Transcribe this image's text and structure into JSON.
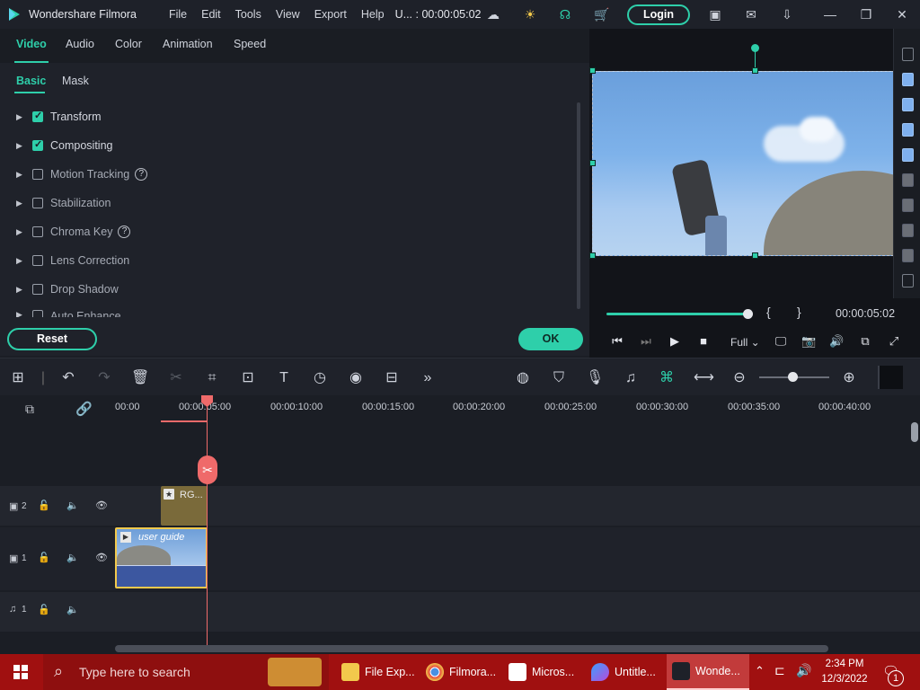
{
  "titlebar": {
    "app_title": "Wondershare Filmora",
    "menu": [
      "File",
      "Edit",
      "Tools",
      "View",
      "Export",
      "Help"
    ],
    "project": "U... : 00:00:05:02",
    "login_label": "Login"
  },
  "panel": {
    "tabs": [
      "Video",
      "Audio",
      "Color",
      "Animation",
      "Speed"
    ],
    "subtabs": [
      "Basic",
      "Mask"
    ],
    "properties": [
      {
        "label": "Transform",
        "checked": true
      },
      {
        "label": "Compositing",
        "checked": true
      },
      {
        "label": "Motion Tracking",
        "checked": false
      },
      {
        "label": "Stabilization",
        "checked": false
      },
      {
        "label": "Chroma Key",
        "checked": false
      },
      {
        "label": "Lens Correction",
        "checked": false
      },
      {
        "label": "Drop Shadow",
        "checked": false
      },
      {
        "label": "Auto Enhance",
        "checked": false
      }
    ],
    "reset_label": "Reset",
    "ok_label": "OK"
  },
  "preview": {
    "mark_in": "{",
    "mark_out": "}",
    "timecode": "00:00:05:02",
    "quality": "Full",
    "progress": 0.97
  },
  "timeline": {
    "ruler_labels": [
      "00:00",
      "00:00:05:00",
      "00:00:10:00",
      "00:00:15:00",
      "00:00:20:00",
      "00:00:25:00",
      "00:00:30:00",
      "00:00:35:00",
      "00:00:40:00"
    ],
    "tracks": [
      {
        "id": "video-2",
        "num": "2"
      },
      {
        "id": "video-1",
        "num": "1"
      },
      {
        "id": "audio-1",
        "num": "1"
      }
    ],
    "clip_v2_name": "RG...",
    "clip_v1_name": "user guide"
  },
  "taskbar": {
    "search_placeholder": "Type here to search",
    "apps": [
      "File Exp...",
      "Filmora...",
      "Micros...",
      "Untitle...",
      "Wonde..."
    ],
    "time": "2:34 PM",
    "date": "12/3/2022",
    "notification_count": "1"
  }
}
